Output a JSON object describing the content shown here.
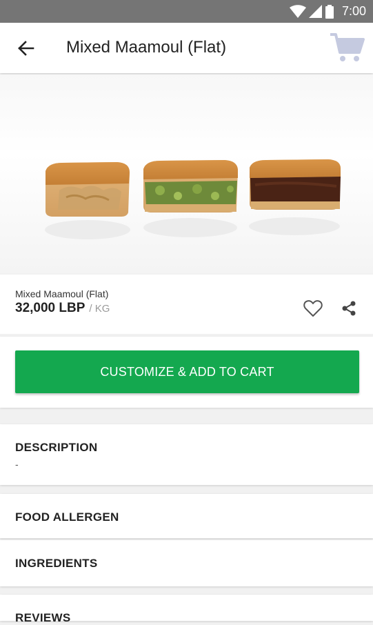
{
  "status_bar": {
    "time": "7:00"
  },
  "app_bar": {
    "title": "Mixed Maamoul (Flat)"
  },
  "product": {
    "name": "Mixed Maamoul (Flat)",
    "price": "32,000 LBP",
    "unit": "/ KG"
  },
  "actions": {
    "cta_label": "CUSTOMIZE & ADD TO CART"
  },
  "sections": {
    "description": {
      "title": "DESCRIPTION",
      "value": "-"
    },
    "food_allergen": {
      "title": "FOOD ALLERGEN"
    },
    "ingredients": {
      "title": "INGREDIENTS"
    },
    "reviews": {
      "title": "REVIEWS"
    }
  },
  "colors": {
    "accent_green": "#14a84f",
    "status_bar": "#757575",
    "cart_icon": "#c5cae0"
  },
  "icons": [
    "wifi-icon",
    "signal-icon",
    "battery-icon",
    "back-arrow-icon",
    "cart-icon",
    "heart-icon",
    "share-icon"
  ]
}
